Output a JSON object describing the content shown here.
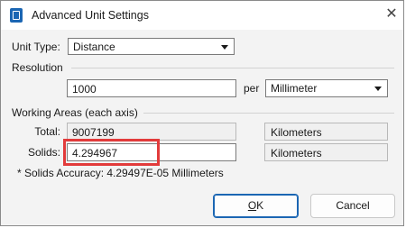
{
  "window": {
    "title": "Advanced Unit Settings",
    "close_glyph": "✕"
  },
  "unit_type": {
    "label": "Unit Type:",
    "value": "Distance"
  },
  "resolution": {
    "section_label": "Resolution",
    "value": "1000",
    "per_label": "per",
    "unit": "Millimeter"
  },
  "working_areas": {
    "section_label": "Working Areas (each axis)",
    "total": {
      "label": "Total:",
      "value": "9007199",
      "unit": "Kilometers"
    },
    "solids": {
      "label": "Solids:",
      "value": "4.294967",
      "unit": "Kilometers"
    }
  },
  "accuracy_text": "* Solids Accuracy: 4.29497E-05 Millimeters",
  "buttons": {
    "ok_mnemonic": "O",
    "ok_rest": "K",
    "cancel": "Cancel"
  },
  "colors": {
    "accent": "#1b66b3",
    "highlight": "#e23b3b"
  }
}
